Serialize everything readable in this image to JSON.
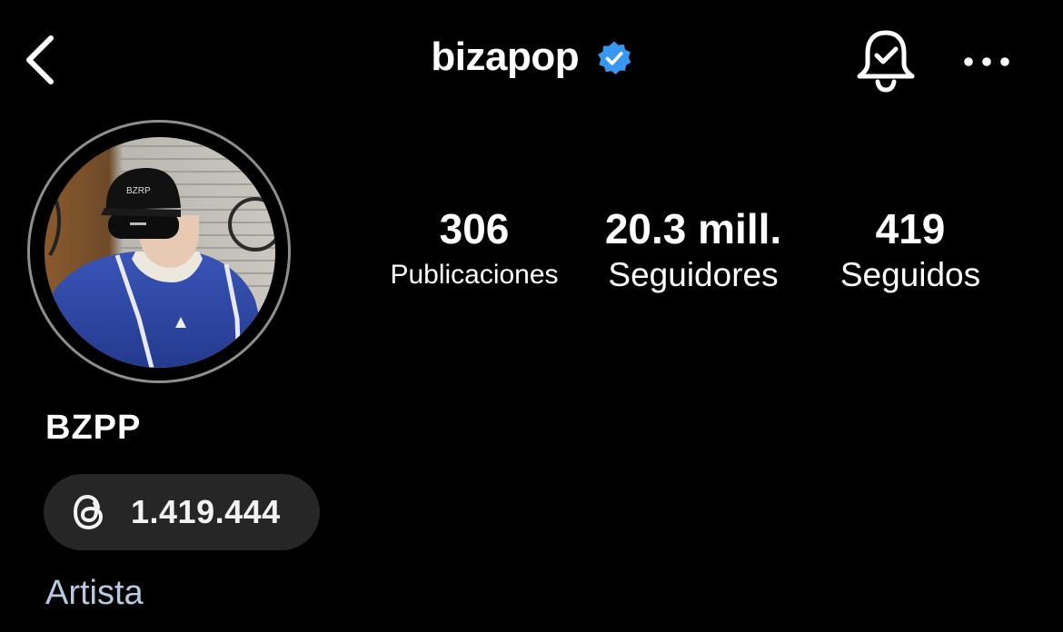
{
  "header": {
    "username": "bizapop",
    "verified": true,
    "back_icon": "chevron-left-icon",
    "bell_icon": "bell-check-icon",
    "more_icon": "ellipsis-icon",
    "verified_color": "#3897f0"
  },
  "profile": {
    "display_name": "BZPP",
    "category": "Artista",
    "stats": {
      "posts_count": "306",
      "posts_label": "Publicaciones",
      "followers_count": "20.3 mill.",
      "followers_label": "Seguidores",
      "following_count": "419",
      "following_label": "Seguidos"
    },
    "threads": {
      "icon": "threads-icon",
      "count": "1.419.444"
    }
  },
  "colors": {
    "background": "#000000",
    "text": "#ffffff",
    "pill_background": "#262626",
    "category_text": "#b9c9e0",
    "avatar_ring": "#8e8e8e"
  }
}
